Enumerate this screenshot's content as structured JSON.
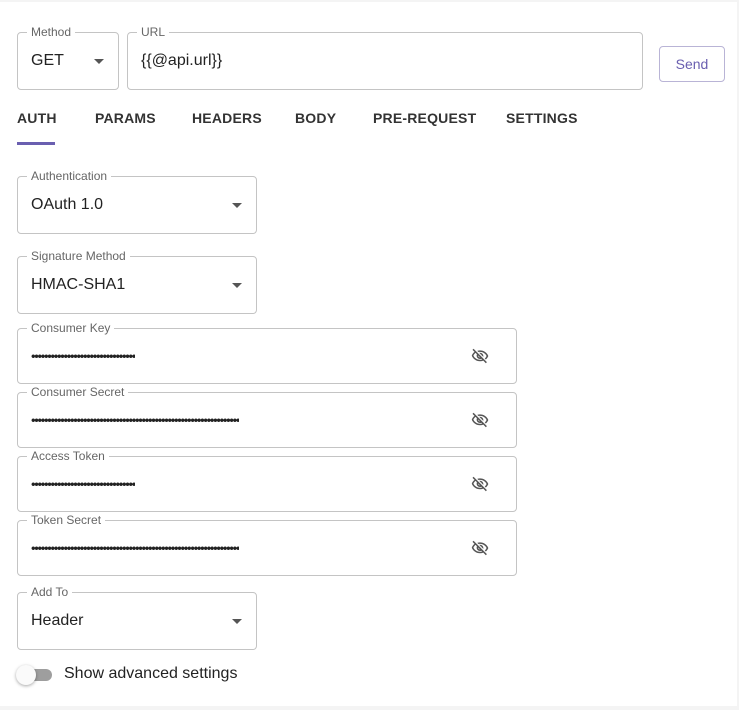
{
  "request": {
    "method_label": "Method",
    "method_value": "GET",
    "url_label": "URL",
    "url_value": "{{@api.url}}",
    "send_label": "Send"
  },
  "tabs": [
    {
      "label": "AUTH",
      "active": true
    },
    {
      "label": "PARAMS",
      "active": false
    },
    {
      "label": "HEADERS",
      "active": false
    },
    {
      "label": "BODY",
      "active": false
    },
    {
      "label": "PRE-REQUEST",
      "active": false
    },
    {
      "label": "SETTINGS",
      "active": false
    }
  ],
  "auth": {
    "authentication": {
      "label": "Authentication",
      "value": "OAuth 1.0"
    },
    "signature_method": {
      "label": "Signature Method",
      "value": "HMAC-SHA1"
    },
    "consumer_key": {
      "label": "Consumer Key",
      "value": "••••••••••••••••••••••••••••••••",
      "icon": "eye-off-icon"
    },
    "consumer_secret": {
      "label": "Consumer Secret",
      "value": "••••••••••••••••••••••••••••••••••••••••••••••••••••••••••••••••",
      "icon": "eye-off-icon"
    },
    "access_token": {
      "label": "Access Token",
      "value": "••••••••••••••••••••••••••••••••",
      "icon": "eye-off-icon"
    },
    "token_secret": {
      "label": "Token Secret",
      "value": "••••••••••••••••••••••••••••••••••••••••••••••••••••••••••••••••",
      "icon": "eye-off-icon"
    },
    "add_to": {
      "label": "Add To",
      "value": "Header"
    },
    "advanced_toggle": {
      "label": "Show advanced settings",
      "checked": false
    }
  },
  "colors": {
    "accent": "#6a5fb0",
    "border": "#c4c4c4",
    "text": "#222222"
  }
}
